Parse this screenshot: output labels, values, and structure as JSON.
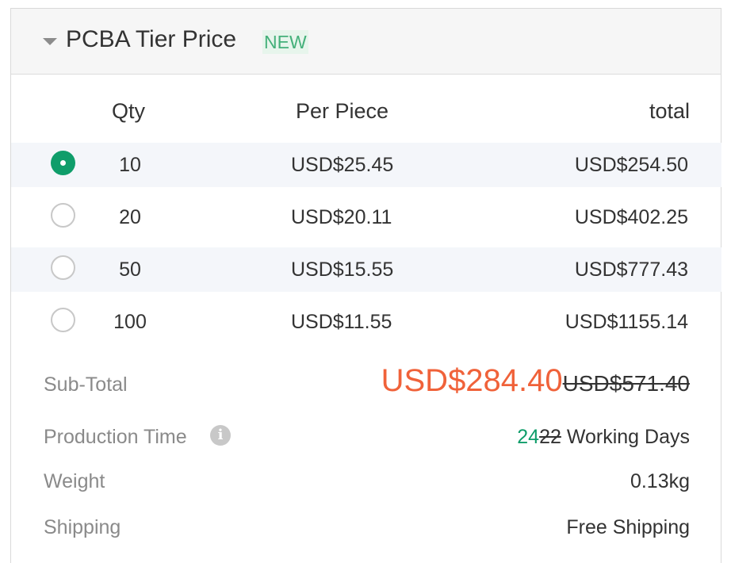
{
  "panel": {
    "title": "PCBA Tier Price",
    "badge": "NEW"
  },
  "table": {
    "headers": {
      "qty": "Qty",
      "per_piece": "Per Piece",
      "total": "total"
    },
    "rows": [
      {
        "qty": "10",
        "per_piece": "USD$25.45",
        "total": "USD$254.50",
        "selected": true
      },
      {
        "qty": "20",
        "per_piece": "USD$20.11",
        "total": "USD$402.25",
        "selected": false
      },
      {
        "qty": "50",
        "per_piece": "USD$15.55",
        "total": "USD$777.43",
        "selected": false
      },
      {
        "qty": "100",
        "per_piece": "USD$11.55",
        "total": "USD$1155.14",
        "selected": false
      }
    ]
  },
  "summary": {
    "subtotal_label": "Sub-Total",
    "subtotal_price": "USD$284.40",
    "subtotal_old_price": "USD$571.40",
    "production_label": "Production Time",
    "production_days_new": "24",
    "production_days_old": "22",
    "production_days_suffix": " Working Days",
    "weight_label": "Weight",
    "weight_value": "0.13kg",
    "shipping_label": "Shipping",
    "shipping_value": "Free Shipping"
  },
  "colors": {
    "accent_green": "#0f9d6a",
    "price_orange": "#f0623a",
    "badge_green": "#44b07a"
  },
  "icons": {
    "collapse": "caret-down-icon",
    "info": "info-icon"
  }
}
